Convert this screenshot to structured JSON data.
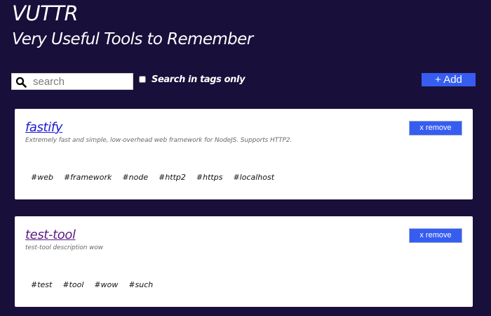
{
  "header": {
    "title": "VUTTR",
    "subtitle": "Very Useful Tools to Remember"
  },
  "toolbar": {
    "search_placeholder": "search",
    "search_value": "",
    "tags_only_label": "Search in tags only",
    "tags_only_checked": false,
    "add_label": "+ Add"
  },
  "tools": [
    {
      "name": "fastify",
      "description": "Extremely fast and simple, low-overhead web framework for NodeJS. Supports HTTP2.",
      "remove_label": "x remove",
      "tags": [
        "#web",
        "#framework",
        "#node",
        "#http2",
        "#https",
        "#localhost"
      ]
    },
    {
      "name": "test-tool",
      "description": "test-tool description wow",
      "remove_label": "x remove",
      "tags": [
        "#test",
        "#tool",
        "#wow",
        "#such"
      ]
    }
  ]
}
